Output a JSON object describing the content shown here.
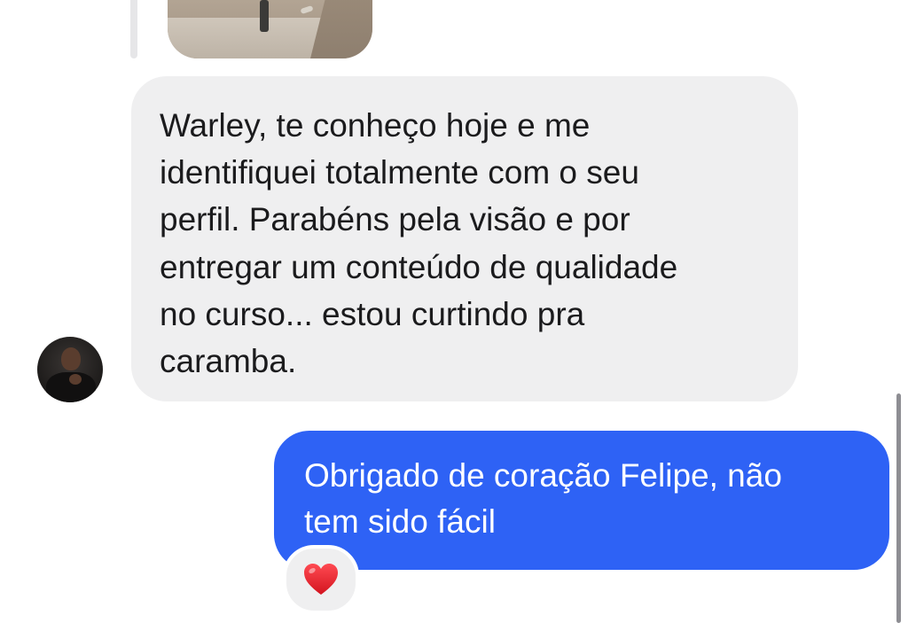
{
  "conversation": {
    "messages": [
      {
        "direction": "received",
        "type": "image",
        "attachment_icon": "photo-thumbnail"
      },
      {
        "direction": "received",
        "type": "text",
        "text": "Warley, te conheço hoje e me\nidentifiquei totalmente com o seu\nperfil. Parabéns pela visão e por\nentregar um conteúdo de qualidade\nno curso... estou curtindo pra\ncaramba.",
        "bubble_color": "#efeff0",
        "text_color": "#1b1b1d"
      },
      {
        "direction": "sent",
        "type": "text",
        "text": "Obrigado de coração Felipe, não\ntem sido fácil",
        "bubble_color": "#2e62f5",
        "text_color": "#ffffff",
        "reaction": {
          "emoji": "❤️",
          "icon": "red-heart-icon",
          "color": "#e8232e"
        }
      }
    ],
    "sender_avatar_icon": "profile-avatar"
  }
}
